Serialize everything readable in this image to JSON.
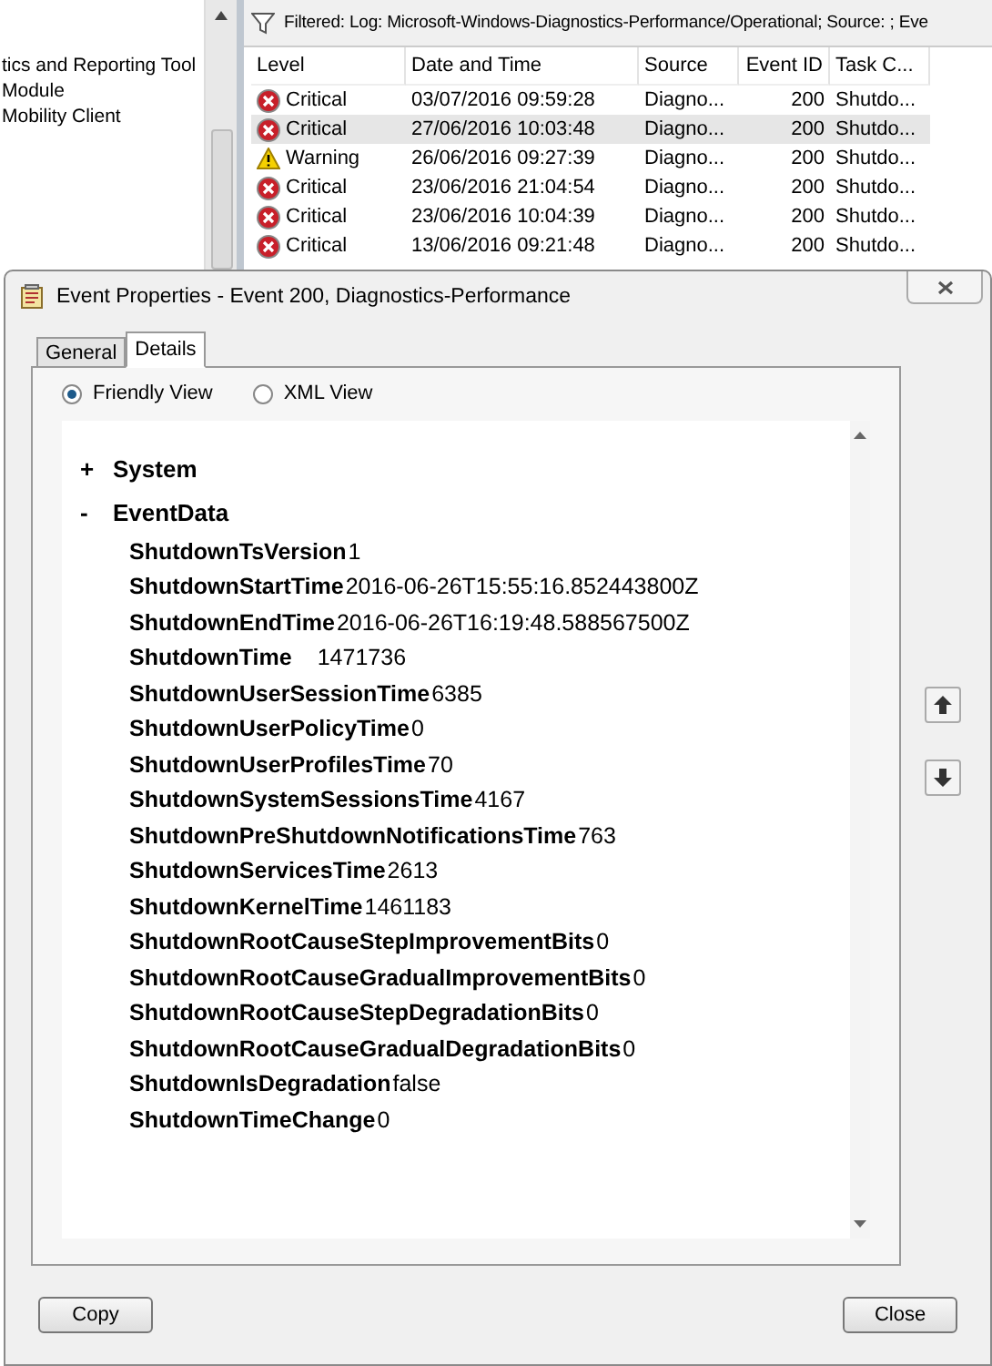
{
  "background_window": {
    "tree_items": [
      "tics and Reporting Tool",
      "Module",
      "Mobility Client"
    ],
    "filter_text": "Filtered: Log: Microsoft-Windows-Diagnostics-Performance/Operational; Source: ; Eve",
    "table": {
      "columns": [
        "Level",
        "Date and Time",
        "Source",
        "Event ID",
        "Task C..."
      ],
      "rows": [
        {
          "kind": "critical",
          "level": "Critical",
          "date": "03/07/2016 09:59:28",
          "source": "Diagno...",
          "event_id": "200",
          "task": "Shutdo...",
          "selected": false
        },
        {
          "kind": "critical",
          "level": "Critical",
          "date": "27/06/2016 10:03:48",
          "source": "Diagno...",
          "event_id": "200",
          "task": "Shutdo...",
          "selected": true
        },
        {
          "kind": "warning",
          "level": "Warning",
          "date": "26/06/2016 09:27:39",
          "source": "Diagno...",
          "event_id": "200",
          "task": "Shutdo...",
          "selected": false
        },
        {
          "kind": "critical",
          "level": "Critical",
          "date": "23/06/2016 21:04:54",
          "source": "Diagno...",
          "event_id": "200",
          "task": "Shutdo...",
          "selected": false
        },
        {
          "kind": "critical",
          "level": "Critical",
          "date": "23/06/2016 10:04:39",
          "source": "Diagno...",
          "event_id": "200",
          "task": "Shutdo...",
          "selected": false
        },
        {
          "kind": "critical",
          "level": "Critical",
          "date": "13/06/2016 09:21:48",
          "source": "Diagno...",
          "event_id": "200",
          "task": "Shutdo...",
          "selected": false
        }
      ]
    }
  },
  "dialog": {
    "title": "Event Properties - Event 200, Diagnostics-Performance",
    "tabs": [
      {
        "label": "General",
        "selected": false
      },
      {
        "label": "Details",
        "selected": true
      }
    ],
    "views": [
      {
        "label": "Friendly View",
        "selected": true
      },
      {
        "label": "XML View",
        "selected": false
      }
    ],
    "tree": [
      {
        "toggle": "+",
        "label": "System"
      },
      {
        "toggle": "-",
        "label": "EventData",
        "children": [
          {
            "name": "ShutdownTsVersion",
            "value": "1"
          },
          {
            "name": "ShutdownStartTime",
            "value": "2016-06-26T15:55:16.852443800Z"
          },
          {
            "name": "ShutdownEndTime",
            "value": "2016-06-26T16:19:48.588567500Z"
          },
          {
            "name": "ShutdownTime",
            "value": "1471736"
          },
          {
            "name": "ShutdownUserSessionTime",
            "value": "6385"
          },
          {
            "name": "ShutdownUserPolicyTime",
            "value": "0"
          },
          {
            "name": "ShutdownUserProfilesTime",
            "value": "70"
          },
          {
            "name": "ShutdownSystemSessionsTime",
            "value": "4167"
          },
          {
            "name": "ShutdownPreShutdownNotificationsTime",
            "value": "763"
          },
          {
            "name": "ShutdownServicesTime",
            "value": "2613"
          },
          {
            "name": "ShutdownKernelTime",
            "value": "1461183"
          },
          {
            "name": "ShutdownRootCauseStepImprovementBits",
            "value": "0"
          },
          {
            "name": "ShutdownRootCauseGradualImprovementBits",
            "value": "0"
          },
          {
            "name": "ShutdownRootCauseStepDegradationBits",
            "value": "0"
          },
          {
            "name": "ShutdownRootCauseGradualDegradationBits",
            "value": "0"
          },
          {
            "name": "ShutdownIsDegradation",
            "value": "false"
          },
          {
            "name": "ShutdownTimeChange",
            "value": "0"
          }
        ]
      }
    ],
    "buttons": [
      "Copy",
      "Close"
    ]
  }
}
